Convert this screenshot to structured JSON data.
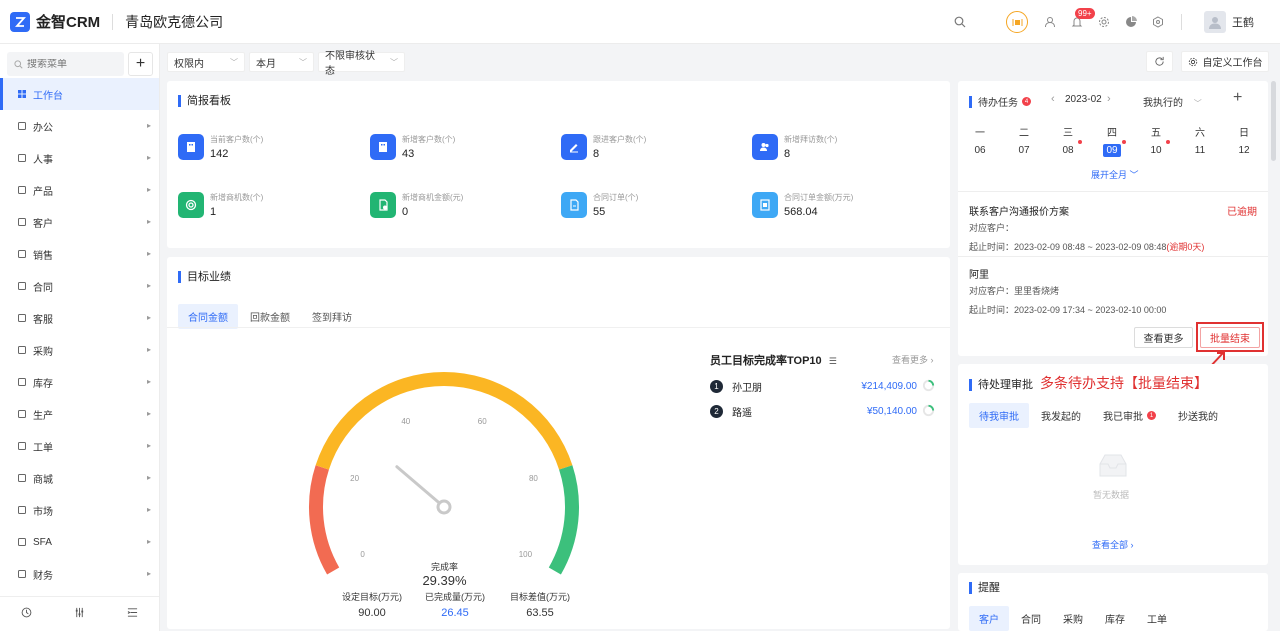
{
  "header": {
    "app_name": "金智CRM",
    "company": "青岛欧克德公司",
    "notif_badge": "99+",
    "user_name": "王鹤"
  },
  "sidebar": {
    "search_placeholder": "搜索菜单",
    "add_label": "+",
    "items": [
      {
        "label": "工作台",
        "icon": "dashboard-icon"
      },
      {
        "label": "办公",
        "icon": "monitor-icon"
      },
      {
        "label": "人事",
        "icon": "org-icon"
      },
      {
        "label": "产品",
        "icon": "cube-icon"
      },
      {
        "label": "客户",
        "icon": "chart-icon"
      },
      {
        "label": "销售",
        "icon": "target-icon"
      },
      {
        "label": "合同",
        "icon": "document-icon"
      },
      {
        "label": "客服",
        "icon": "headset-icon"
      },
      {
        "label": "采购",
        "icon": "basket-icon"
      },
      {
        "label": "库存",
        "icon": "warehouse-icon"
      },
      {
        "label": "生产",
        "icon": "factory-icon"
      },
      {
        "label": "工单",
        "icon": "ticket-icon"
      },
      {
        "label": "商城",
        "icon": "shop-icon"
      },
      {
        "label": "市场",
        "icon": "calendar-icon"
      },
      {
        "label": "SFA",
        "icon": "gear-icon"
      },
      {
        "label": "财务",
        "icon": "finance-icon"
      }
    ]
  },
  "filters": {
    "scope": "权限内",
    "period": "本月",
    "audit": "不限审核状态",
    "custom_label": "自定义工作台"
  },
  "briefing": {
    "title": "简报看板",
    "stats": [
      {
        "label": "当前客户数(个)",
        "value": "142",
        "color": "#2f6bf6"
      },
      {
        "label": "新增客户数(个)",
        "value": "43",
        "color": "#2f6bf6"
      },
      {
        "label": "跟进客户数(个)",
        "value": "8",
        "color": "#2f6bf6"
      },
      {
        "label": "新增拜访数(个)",
        "value": "8",
        "color": "#2f6bf6"
      },
      {
        "label": "新增商机数(个)",
        "value": "1",
        "color": "#22b573"
      },
      {
        "label": "新增商机金额(元)",
        "value": "0",
        "color": "#22b573"
      },
      {
        "label": "合同订单(个)",
        "value": "55",
        "color": "#3ea8f5"
      },
      {
        "label": "合同订单金额(万元)",
        "value": "568.04",
        "color": "#3ea8f5"
      }
    ]
  },
  "target": {
    "title": "目标业绩",
    "tabs": [
      "合同金额",
      "回款金额",
      "签到拜访"
    ],
    "gauge": {
      "ticks": [
        "0",
        "20",
        "40",
        "60",
        "80",
        "100"
      ],
      "completion_label": "完成率",
      "completion_value": "29.39%",
      "percent": 29.39,
      "colors": {
        "low": "#f26b52",
        "mid": "#fbb623",
        "high": "#3cc07c"
      }
    },
    "summary": [
      {
        "label": "设定目标(万元)",
        "value": "90.00"
      },
      {
        "label": "已完成量(万元)",
        "value": "26.45"
      },
      {
        "label": "目标差值(万元)",
        "value": "63.55"
      }
    ],
    "top10": {
      "title": "员工目标完成率TOP10",
      "more": "查看更多",
      "rows": [
        {
          "rank": "1",
          "name": "孙卫朋",
          "amount": "¥214,409.00"
        },
        {
          "rank": "2",
          "name": "路遥",
          "amount": "¥50,140.00"
        }
      ]
    }
  },
  "todo": {
    "title": "待办任务",
    "badge": "4",
    "month": "2023-02",
    "filter": "我执行的",
    "weekdays": [
      "一",
      "二",
      "三",
      "四",
      "五",
      "六",
      "日"
    ],
    "days": [
      "06",
      "07",
      "08",
      "09",
      "10",
      "11",
      "12"
    ],
    "expand": "展开全月",
    "tasks": [
      {
        "title": "联系客户沟通报价方案",
        "status": "已逾期",
        "customer": "对应客户：",
        "time": "起止时间：2023-02-09 08:48 ~ 2023-02-09 08:48",
        "overdue": "(逾期0天)"
      },
      {
        "title": "阿里",
        "customer": "对应客户：里里香烧烤",
        "time": "起止时间：2023-02-09 17:34 ~ 2023-02-10 00:00"
      }
    ],
    "view_more": "查看更多",
    "batch_end": "批量结束"
  },
  "annotation": "多条待办支持【批量结束】",
  "approval": {
    "title": "待处理审批",
    "tabs": [
      "待我审批",
      "我发起的",
      "我已审批",
      "抄送我的"
    ],
    "approved_badge": "1",
    "empty": "暂无数据",
    "view_all": "查看全部"
  },
  "reminder": {
    "title": "提醒",
    "tabs": [
      "客户",
      "合同",
      "采购",
      "库存",
      "工单"
    ]
  }
}
